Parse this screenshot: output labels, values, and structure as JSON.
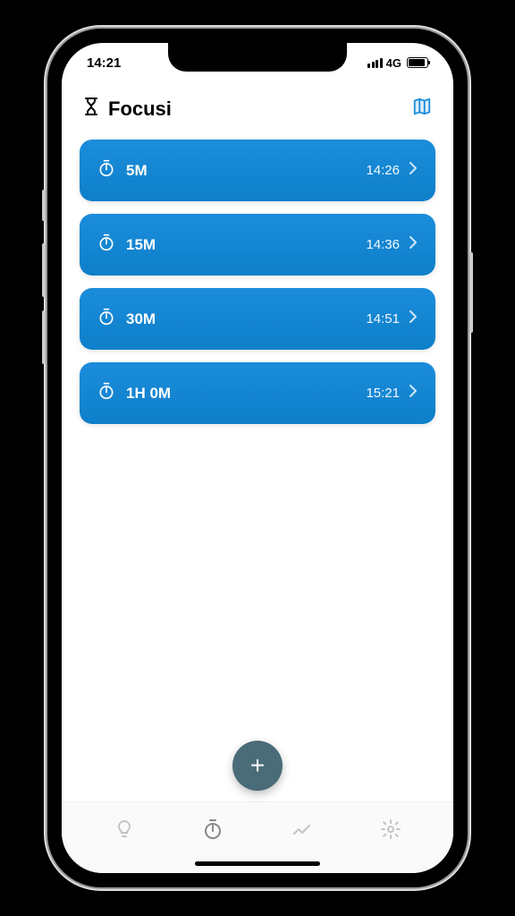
{
  "status": {
    "time": "14:21",
    "network": "4G"
  },
  "header": {
    "title": "Focusi"
  },
  "timers": [
    {
      "label": "5M",
      "end": "14:26"
    },
    {
      "label": "15M",
      "end": "14:36"
    },
    {
      "label": "30M",
      "end": "14:51"
    },
    {
      "label": "1H 0M",
      "end": "15:21"
    }
  ],
  "colors": {
    "primary": "#1b8ddb",
    "fab": "#4a6b78"
  }
}
